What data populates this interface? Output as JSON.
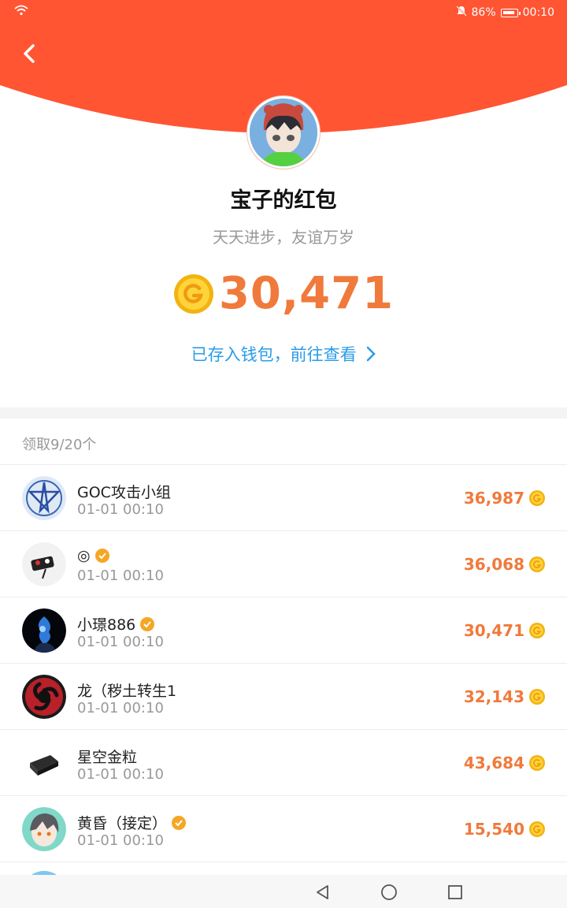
{
  "status_bar": {
    "battery": "86%",
    "time": "00:10"
  },
  "header": {
    "title": "宝子的红包",
    "subtitle": "天天进步，友谊万岁"
  },
  "amount": "30,471",
  "wallet_link": "已存入钱包，前往查看",
  "claim_count": "领取9/20个",
  "colors": {
    "brand_red": "#ff5533",
    "amount_orange": "#f07a3c",
    "link_blue": "#2a9ce8"
  },
  "records": [
    {
      "name": "GOC攻击小组",
      "verified": false,
      "time": "01-01 00:10",
      "amount": "36,987"
    },
    {
      "name": "◎",
      "verified": true,
      "time": "01-01 00:10",
      "amount": "36,068"
    },
    {
      "name": "小璟886",
      "verified": true,
      "time": "01-01 00:10",
      "amount": "30,471"
    },
    {
      "name": "龙（秽土转生1",
      "verified": false,
      "time": "01-01 00:10",
      "amount": "32,143"
    },
    {
      "name": "星空金粒",
      "verified": false,
      "time": "01-01 00:10",
      "amount": "43,684"
    },
    {
      "name": "黄昏（接定）",
      "verified": true,
      "time": "01-01 00:10",
      "amount": "15,540"
    }
  ],
  "icons": [
    "wifi-icon",
    "mute-icon",
    "battery-icon",
    "back-icon",
    "coin-icon",
    "chevron-right-icon",
    "verified-badge-icon",
    "nav-back-icon",
    "nav-home-icon",
    "nav-recents-icon"
  ]
}
